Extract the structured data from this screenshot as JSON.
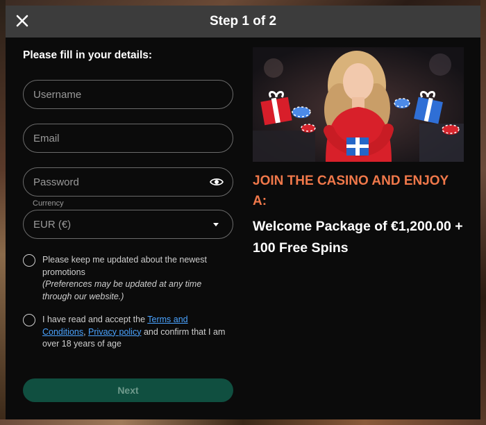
{
  "modal": {
    "title": "Step 1 of 2"
  },
  "form": {
    "heading": "Please fill in your details:",
    "username_placeholder": "Username",
    "email_placeholder": "Email",
    "password_placeholder": "Password",
    "currency_label": "Currency",
    "currency_value": "EUR (€)",
    "updates_text": "Please keep me updated about the newest promotions",
    "updates_note": "(Preferences may be updated at any time through our website.)",
    "terms_prefix": "I have read and accept the",
    "terms_link": "Terms and Conditions",
    "terms_comma": ",",
    "privacy_link": "Privacy policy",
    "terms_suffix": "and confirm that I am over 18 years of age",
    "next_label": "Next"
  },
  "promo": {
    "headline": "JOIN THE CASINO AND ENJOY A:",
    "offer": "Welcome Package of €1,200.00 + 100 Free Spins"
  },
  "colors": {
    "header_bg": "#3c3c3c",
    "modal_bg": "#0b0b0b",
    "accent_orange": "#f0784a",
    "link_blue": "#4aa3ff",
    "next_button_bg": "#104f40"
  }
}
